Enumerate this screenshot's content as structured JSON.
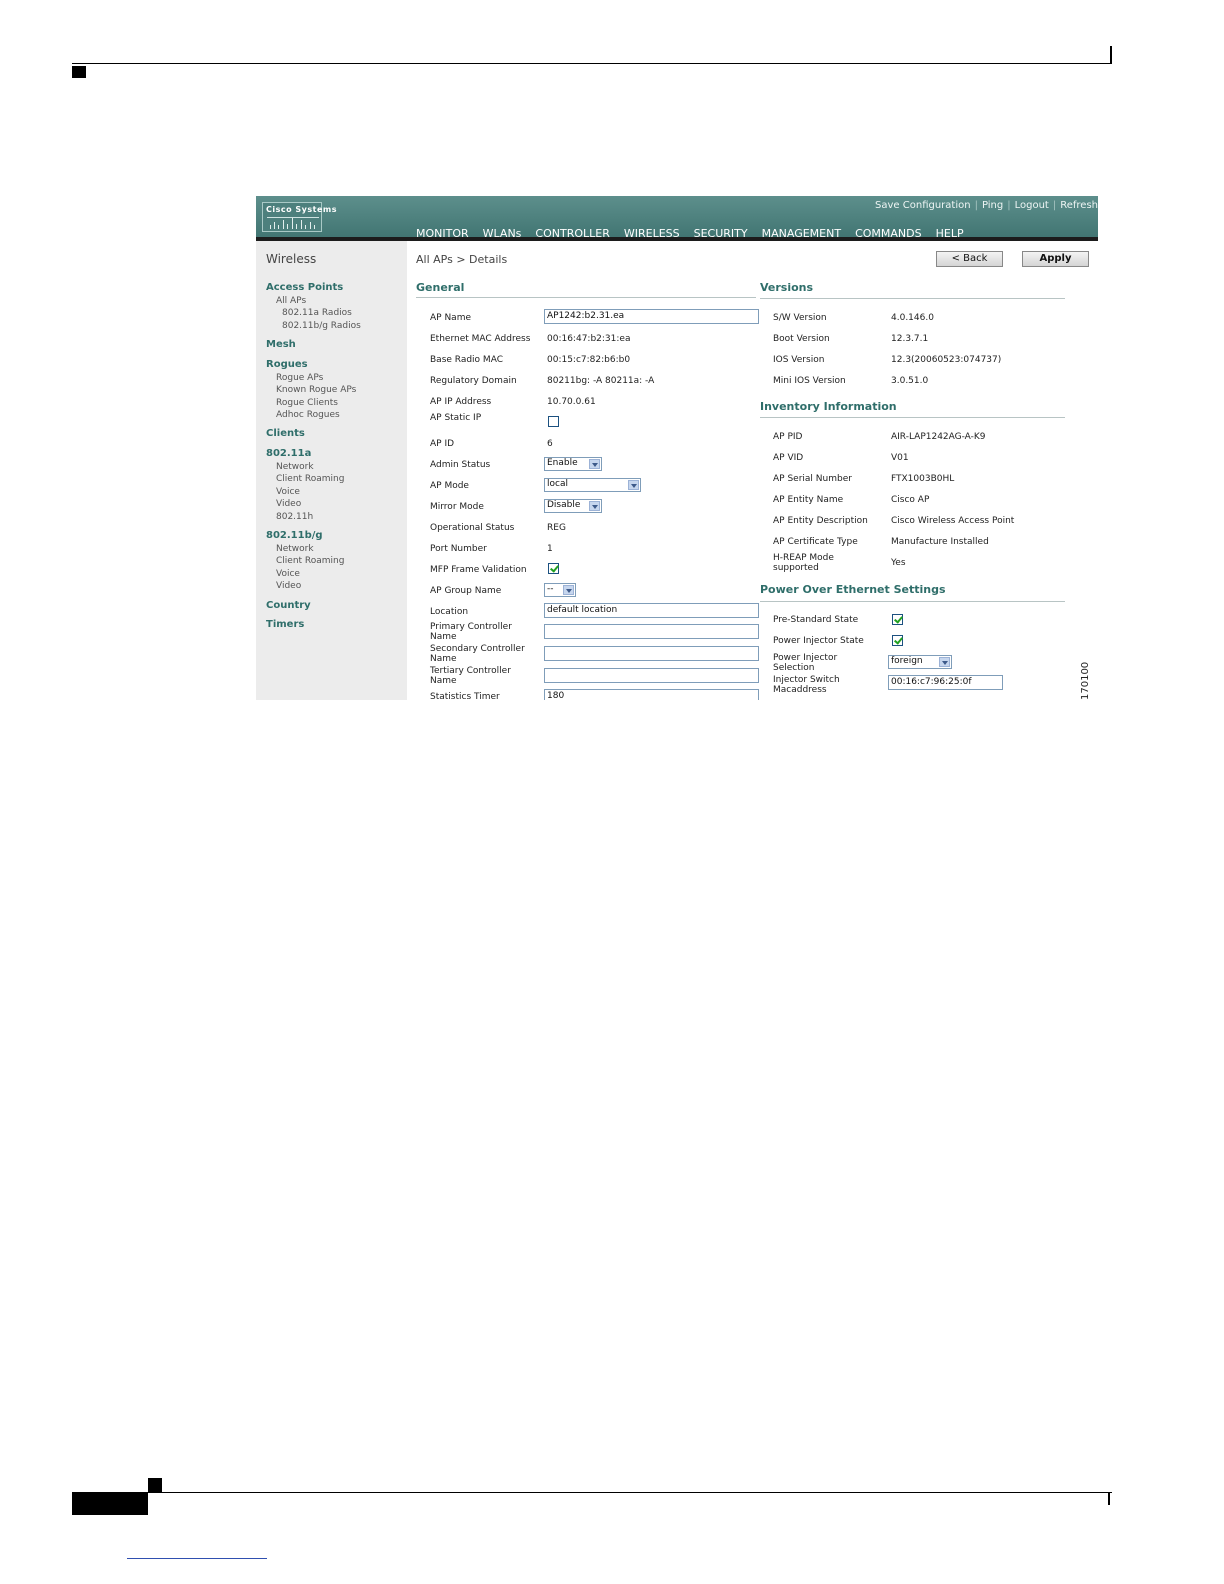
{
  "banner": {
    "logo_text": "Cisco Systems",
    "top_links": [
      "Save Configuration",
      "Ping",
      "Logout",
      "Refresh"
    ],
    "nav": [
      "MONITOR",
      "WLANs",
      "CONTROLLER",
      "WIRELESS",
      "SECURITY",
      "MANAGEMENT",
      "COMMANDS",
      "HELP"
    ],
    "active_nav": "WIRELESS",
    "active_color": "#f0a028"
  },
  "sidebar": {
    "title": "Wireless",
    "access_points": "Access Points",
    "all_aps": "All APs",
    "radios_a": "802.11a Radios",
    "radios_bg": "802.11b/g Radios",
    "mesh": "Mesh",
    "rogues": "Rogues",
    "rogue_aps": "Rogue APs",
    "known_rogue_aps": "Known Rogue APs",
    "rogue_clients": "Rogue Clients",
    "adhoc_rogues": "Adhoc Rogues",
    "clients": "Clients",
    "a_head": "802.11a",
    "a_network": "Network",
    "a_roaming": "Client Roaming",
    "a_voice": "Voice",
    "a_video": "Video",
    "a_80211h": "802.11h",
    "bg_head": "802.11b/g",
    "bg_network": "Network",
    "bg_roaming": "Client Roaming",
    "bg_voice": "Voice",
    "bg_video": "Video",
    "country": "Country",
    "timers": "Timers"
  },
  "page": {
    "breadcrumb": "All APs > Details",
    "back_label": "< Back",
    "apply_label": "Apply"
  },
  "general": {
    "heading": "General",
    "ap_name_label": "AP Name",
    "ap_name": "AP1242:b2.31.ea",
    "eth_mac_label": "Ethernet MAC Address",
    "eth_mac": "00:16:47:b2:31:ea",
    "radio_mac_label": "Base Radio MAC",
    "radio_mac": "00:15:c7:82:b6:b0",
    "reg_domain_label": "Regulatory Domain",
    "reg_domain": "80211bg: -A 80211a: -A",
    "ip_label": "AP IP Address",
    "ip": "10.70.0.61",
    "static_ip_label": "AP Static IP",
    "static_ip": false,
    "ap_id_label": "AP ID",
    "ap_id": "6",
    "admin_status_label": "Admin Status",
    "admin_status": "Enable",
    "ap_mode_label": "AP Mode",
    "ap_mode": "local",
    "mirror_mode_label": "Mirror Mode",
    "mirror_mode": "Disable",
    "op_status_label": "Operational Status",
    "op_status": "REG",
    "port_label": "Port Number",
    "port": "1",
    "mfp_label": "MFP Frame Validation",
    "mfp": true,
    "group_label": "AP Group Name",
    "group": "--",
    "location_label": "Location",
    "location": "default location",
    "primary_label": "Primary Controller Name",
    "primary": "",
    "secondary_label": "Secondary Controller Name",
    "secondary": "",
    "tertiary_label": "Tertiary Controller Name",
    "tertiary": "",
    "stats_label": "Statistics Timer",
    "stats": "180"
  },
  "versions": {
    "heading": "Versions",
    "sw_label": "S/W Version",
    "sw": "4.0.146.0",
    "boot_label": "Boot Version",
    "boot": "12.3.7.1",
    "ios_label": "IOS Version",
    "ios": "12.3(20060523:074737)",
    "mini_label": "Mini IOS Version",
    "mini": "3.0.51.0"
  },
  "inventory": {
    "heading": "Inventory Information",
    "pid_label": "AP PID",
    "pid": "AIR-LAP1242AG-A-K9",
    "vid_label": "AP VID",
    "vid": "V01",
    "serial_label": "AP Serial Number",
    "serial": "FTX1003B0HL",
    "entity_label": "AP Entity Name",
    "entity": "Cisco AP",
    "desc_label": "AP Entity Description",
    "desc": "Cisco Wireless Access Point",
    "cert_label": "AP Certificate Type",
    "cert": "Manufacture Installed",
    "hreap_label": "H-REAP Mode supported",
    "hreap": "Yes"
  },
  "poe": {
    "heading": "Power Over Ethernet Settings",
    "prestd_label": "Pre-Standard State",
    "prestd": true,
    "injector_label": "Power Injector State",
    "injector": true,
    "selection_label": "Power Injector Selection",
    "selection": "foreign",
    "mac_label": "Injector Switch Macaddress",
    "mac": "00:16:c7:96:25:0f"
  },
  "figure_id": "170100"
}
